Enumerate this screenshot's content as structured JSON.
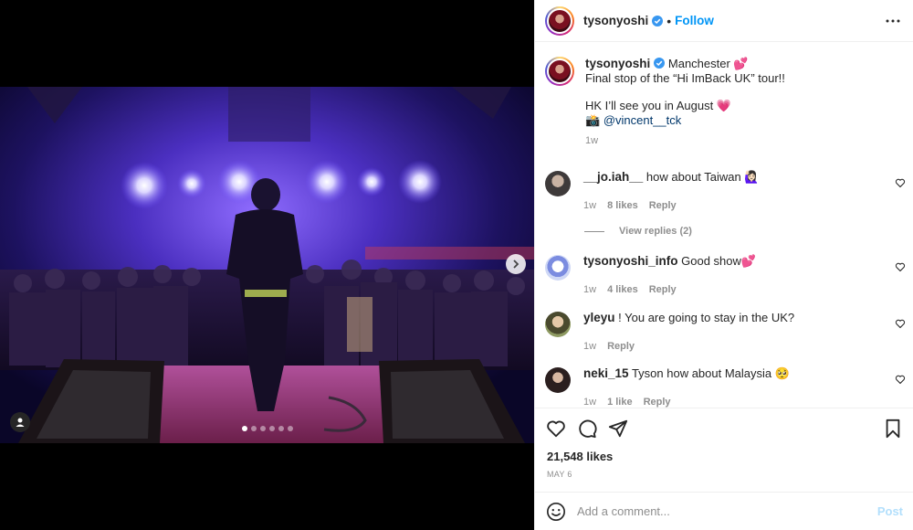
{
  "post": {
    "username": "tysonyoshi",
    "follow_label": "Follow",
    "separator": "•",
    "carousel": {
      "slide_count": 6,
      "active_slide": 1
    }
  },
  "caption": {
    "username": "tysonyoshi",
    "line1": "Manchester 💕",
    "line2": "Final stop of the “Hi ImBack UK” tour!!",
    "line3": "HK I’ll see you in August 💗",
    "camera": "📸",
    "mention": "@vincent__tck",
    "time": "1w"
  },
  "comments": [
    {
      "username": "__jo.iah__",
      "text": "how about Taiwan 🙋🏻‍♀️",
      "time": "1w",
      "likes": "8 likes",
      "reply": "Reply"
    },
    {
      "username": "tysonyoshi_info",
      "text": "Good show💕",
      "time": "1w",
      "likes": "4 likes",
      "reply": "Reply"
    },
    {
      "username": "yleyu",
      "text": "! You are going to stay in the UK?",
      "time": "1w",
      "likes": "",
      "reply": "Reply"
    },
    {
      "username": "neki_15",
      "text": "Tyson how about Malaysia 🥺",
      "time": "1w",
      "likes": "1 like",
      "reply": "Reply"
    }
  ],
  "view_replies": "View replies (2)",
  "engagement": {
    "likes": "21,548 likes",
    "date": "MAY 6"
  },
  "composer": {
    "placeholder": "Add a comment...",
    "post_label": "Post"
  },
  "colors": {
    "link": "#0095f6",
    "mention": "#00376b",
    "muted": "#8e8e8e",
    "post_disabled": "#b2dffc"
  },
  "icons": [
    "chevron-right-icon",
    "user-tag-icon",
    "verified-badge-icon",
    "more-options-icon",
    "heart-icon",
    "comment-icon",
    "share-icon",
    "bookmark-icon",
    "emoji-icon"
  ]
}
